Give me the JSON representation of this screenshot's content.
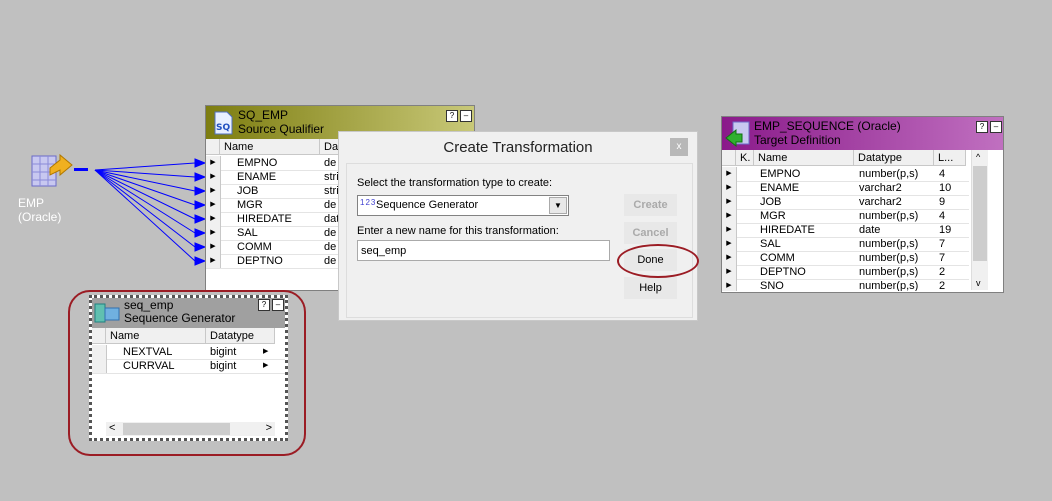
{
  "source": {
    "label": "EMP (Oracle)",
    "icon": "source-table-icon"
  },
  "sq": {
    "title": "SQ_EMP",
    "subtitle": "Source Qualifier",
    "headers": [
      "Name",
      "Data"
    ],
    "rows": [
      [
        "EMPNO",
        "de"
      ],
      [
        "ENAME",
        "stri"
      ],
      [
        "JOB",
        "stri"
      ],
      [
        "MGR",
        "de"
      ],
      [
        "HIREDATE",
        "dat"
      ],
      [
        "SAL",
        "de"
      ],
      [
        "COMM",
        "de"
      ],
      [
        "DEPTNO",
        "de"
      ]
    ]
  },
  "target": {
    "title": "EMP_SEQUENCE (Oracle)",
    "subtitle": "Target Definition",
    "headers": [
      "K.",
      "Name",
      "Datatype",
      "L..."
    ],
    "rows": [
      [
        "EMPNO",
        "number(p,s)",
        "4"
      ],
      [
        "ENAME",
        "varchar2",
        "10"
      ],
      [
        "JOB",
        "varchar2",
        "9"
      ],
      [
        "MGR",
        "number(p,s)",
        "4"
      ],
      [
        "HIREDATE",
        "date",
        "19"
      ],
      [
        "SAL",
        "number(p,s)",
        "7"
      ],
      [
        "COMM",
        "number(p,s)",
        "7"
      ],
      [
        "DEPTNO",
        "number(p,s)",
        "2"
      ],
      [
        "SNO",
        "number(p,s)",
        "2"
      ]
    ]
  },
  "seq": {
    "title": "seq_emp",
    "subtitle": "Sequence Generator",
    "headers": [
      "Name",
      "Datatype"
    ],
    "rows": [
      [
        "NEXTVAL",
        "bigint"
      ],
      [
        "CURRVAL",
        "bigint"
      ]
    ]
  },
  "dialog": {
    "title": "Create Transformation",
    "close": "x",
    "type_label": "Select the transformation type to create:",
    "type_icon": "123",
    "type_value": "Sequence Generator",
    "name_label": "Enter a new name for this transformation:",
    "name_value": "seq_emp",
    "buttons": {
      "create": "Create",
      "cancel": "Cancel",
      "done": "Done",
      "help": "Help"
    }
  },
  "colors": {
    "sq_title": "#9a9a30",
    "target_title": "#9a2a9a",
    "seq_title": "#a0a0a0",
    "links": "#0000ff",
    "highlight": "#9b1c24"
  }
}
